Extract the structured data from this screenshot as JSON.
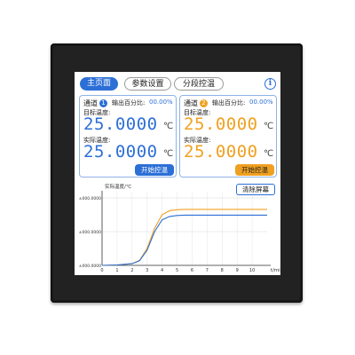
{
  "tabs": [
    {
      "label": "主页面",
      "active": true
    },
    {
      "label": "参数设置",
      "active": false
    },
    {
      "label": "分段控温",
      "active": false
    }
  ],
  "info_icon": "i",
  "channels": [
    {
      "title": "通道",
      "number": "1",
      "color": "#2c6fd6",
      "output_label": "输出百分比:",
      "output_value": "00.00%",
      "target_label": "目标温度:",
      "target_value": "25.0000",
      "target_unit": "℃",
      "actual_label": "实际温度:",
      "actual_value": "25.0000",
      "actual_unit": "℃",
      "button_label": "开始控温",
      "button_color": "#2c6fd6"
    },
    {
      "title": "通道",
      "number": "2",
      "color": "#f0a020",
      "output_label": "输出百分比:",
      "output_value": "00.00%",
      "target_label": "目标温度:",
      "target_value": "25.0000",
      "target_unit": "℃",
      "actual_label": "实际温度:",
      "actual_value": "25.0000",
      "actual_unit": "℃",
      "button_label": "开始控温",
      "button_color": "#f0a020"
    }
  ],
  "clear_button": "清除屏幕",
  "chart_data": {
    "type": "line",
    "ylabel": "实际温度/℃",
    "xlabel": "t/min",
    "xlim": [
      0,
      11
    ],
    "ylim": [
      0,
      2
    ],
    "y_ticks": [
      {
        "value": 0,
        "label": "±000.0000"
      },
      {
        "value": 1,
        "label": "±000.0000"
      },
      {
        "value": 2,
        "label": "±000.0000"
      }
    ],
    "x_ticks": [
      0,
      1,
      2,
      3,
      4,
      5,
      6,
      7,
      8,
      9,
      10
    ],
    "grid": true,
    "series": [
      {
        "color": "#f0a020",
        "x": [
          0,
          1,
          2,
          2.5,
          3,
          3.5,
          4,
          4.5,
          5,
          5.5,
          6,
          7,
          8,
          9,
          10,
          11
        ],
        "y": [
          0,
          0.01,
          0.05,
          0.15,
          0.5,
          1.1,
          1.5,
          1.62,
          1.65,
          1.66,
          1.66,
          1.66,
          1.66,
          1.66,
          1.66,
          1.66
        ]
      },
      {
        "color": "#2c6fd6",
        "x": [
          0,
          1,
          2,
          2.5,
          3,
          3.5,
          4,
          4.5,
          5,
          5.5,
          6,
          7,
          8,
          9,
          10,
          11
        ],
        "y": [
          0,
          0.01,
          0.05,
          0.14,
          0.45,
          1.0,
          1.35,
          1.45,
          1.48,
          1.49,
          1.49,
          1.49,
          1.49,
          1.49,
          1.49,
          1.49
        ]
      }
    ]
  }
}
